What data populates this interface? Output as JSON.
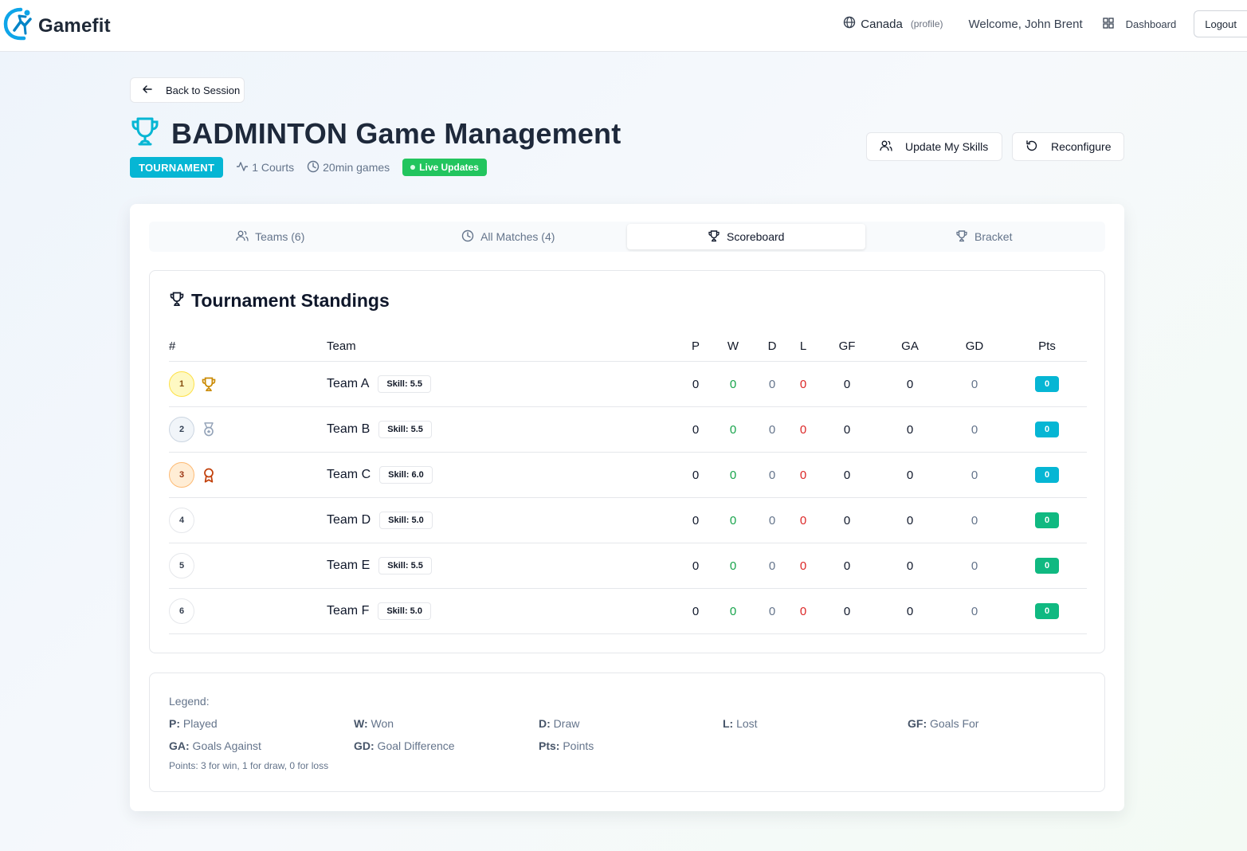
{
  "header": {
    "logo_text": "Gamefit",
    "country": "Canada",
    "profile_link": "(profile)",
    "welcome": "Welcome, John Brent",
    "dashboard_label": "Dashboard",
    "logout_label": "Logout"
  },
  "page": {
    "back_label": "Back to Session",
    "title": "BADMINTON Game Management",
    "format_badge": "TOURNAMENT",
    "courts": "1 Courts",
    "game_length": "20min games",
    "live_badge": "Live Updates",
    "update_skills_label": "Update My Skills",
    "reconfigure_label": "Reconfigure"
  },
  "tabs": [
    {
      "label": "Teams (6)",
      "icon": "users-icon",
      "active": false
    },
    {
      "label": "All Matches (4)",
      "icon": "clock-icon",
      "active": false
    },
    {
      "label": "Scoreboard",
      "icon": "trophy-icon",
      "active": true
    },
    {
      "label": "Bracket",
      "icon": "trophy-icon",
      "active": false
    }
  ],
  "standings": {
    "title": "Tournament Standings",
    "columns": [
      "#",
      "Team",
      "P",
      "W",
      "D",
      "L",
      "GF",
      "GA",
      "GD",
      "Pts"
    ],
    "rows": [
      {
        "rank": "1",
        "medal": "trophy-icon",
        "team": "Team A",
        "skill": "Skill: 5.5",
        "p": "0",
        "w": "0",
        "d": "0",
        "l": "0",
        "gf": "0",
        "ga": "0",
        "gd": "0",
        "pts": "0"
      },
      {
        "rank": "2",
        "medal": "medal-icon",
        "team": "Team B",
        "skill": "Skill: 5.5",
        "p": "0",
        "w": "0",
        "d": "0",
        "l": "0",
        "gf": "0",
        "ga": "0",
        "gd": "0",
        "pts": "0"
      },
      {
        "rank": "3",
        "medal": "award-icon",
        "team": "Team C",
        "skill": "Skill: 6.0",
        "p": "0",
        "w": "0",
        "d": "0",
        "l": "0",
        "gf": "0",
        "ga": "0",
        "gd": "0",
        "pts": "0"
      },
      {
        "rank": "4",
        "medal": "",
        "team": "Team D",
        "skill": "Skill: 5.0",
        "p": "0",
        "w": "0",
        "d": "0",
        "l": "0",
        "gf": "0",
        "ga": "0",
        "gd": "0",
        "pts": "0"
      },
      {
        "rank": "5",
        "medal": "",
        "team": "Team E",
        "skill": "Skill: 5.5",
        "p": "0",
        "w": "0",
        "d": "0",
        "l": "0",
        "gf": "0",
        "ga": "0",
        "gd": "0",
        "pts": "0"
      },
      {
        "rank": "6",
        "medal": "",
        "team": "Team F",
        "skill": "Skill: 5.0",
        "p": "0",
        "w": "0",
        "d": "0",
        "l": "0",
        "gf": "0",
        "ga": "0",
        "gd": "0",
        "pts": "0"
      }
    ]
  },
  "legend": {
    "title": "Legend:",
    "items": [
      {
        "key": "P:",
        "text": " Played"
      },
      {
        "key": "W:",
        "text": " Won"
      },
      {
        "key": "D:",
        "text": " Draw"
      },
      {
        "key": "L:",
        "text": " Lost"
      },
      {
        "key": "GF:",
        "text": " Goals For"
      },
      {
        "key": "GA:",
        "text": " Goals Against"
      },
      {
        "key": "GD:",
        "text": " Goal Difference"
      },
      {
        "key": "Pts:",
        "text": " Points"
      }
    ],
    "note": "Points: 3 for win, 1 for draw, 0 for loss"
  },
  "colors": {
    "accent": "#06b6d4",
    "live": "#22c55e",
    "win": "#16a34a",
    "loss": "#dc2626",
    "gold": "#ca8a04",
    "bronze": "#c2410c"
  }
}
